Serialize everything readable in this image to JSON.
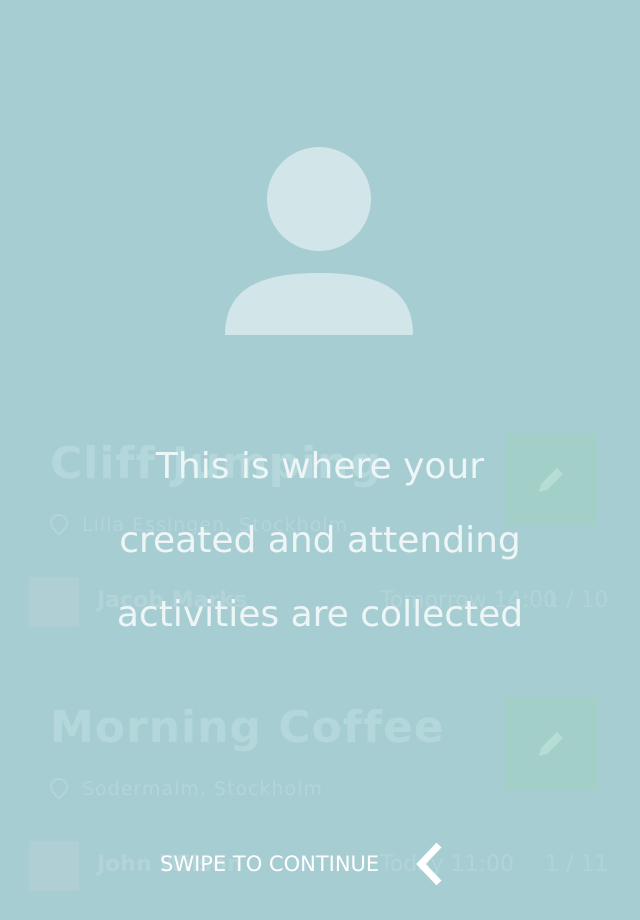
{
  "cards": [
    {
      "title": "Cliff Jumping",
      "location": "Lilla Essingen, Stockholm",
      "host": "Jacob Marks",
      "time": "Tomorrow 14:00",
      "extra": "1 / 10"
    },
    {
      "title": "Morning Coffee",
      "location": "Sodermalm, Stockholm",
      "host": "John Wilson",
      "time": "Today 11:00",
      "extra": "1 / 11"
    }
  ],
  "overlay": {
    "line1": "This is where your",
    "line2": "created and attending",
    "line3": "activities are collected",
    "swipe_label": "SWIPE TO CONTINUE"
  },
  "icons": {
    "avatar": "user-placeholder-icon",
    "swipe": "chevron-left-icon",
    "edit": "pencil-icon",
    "location": "map-pin-icon"
  },
  "colors": {
    "background": "#a6cdd2",
    "text": "#ffffff"
  }
}
